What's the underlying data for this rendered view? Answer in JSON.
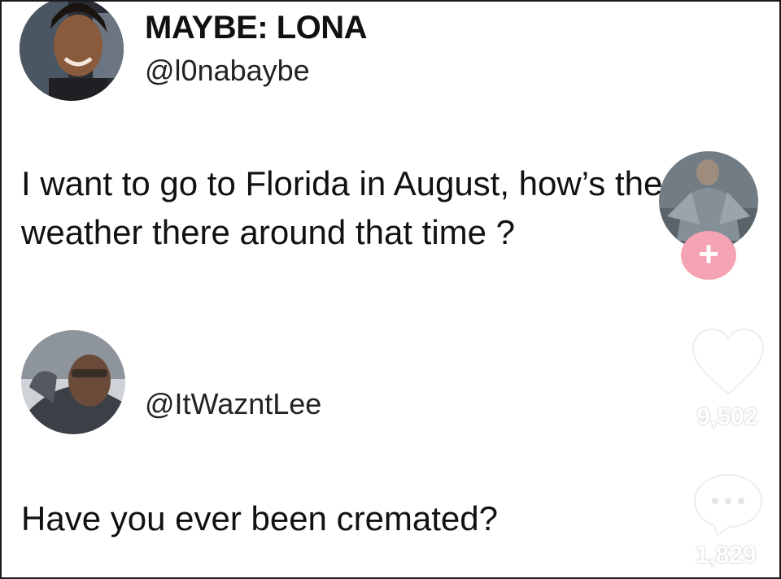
{
  "original_post": {
    "display_name": "MAYBE: LONA",
    "handle": "@l0nabaybe",
    "text_line1": "I want to go to Florida in August, how’s the",
    "text_line2": "weather there around that time ?"
  },
  "reply_post": {
    "handle": "@ItWazntLee",
    "text": "Have you ever been cremated?"
  },
  "side_actions": {
    "follow_label": "+",
    "like_count": "9,502",
    "comment_count": "1,829"
  },
  "icons": {
    "like": "heart-icon",
    "comment": "comment-bubble-icon",
    "follow": "plus-icon"
  },
  "colors": {
    "follow_button": "#f4a3b4",
    "text": "#111111",
    "background": "#ffffff"
  }
}
